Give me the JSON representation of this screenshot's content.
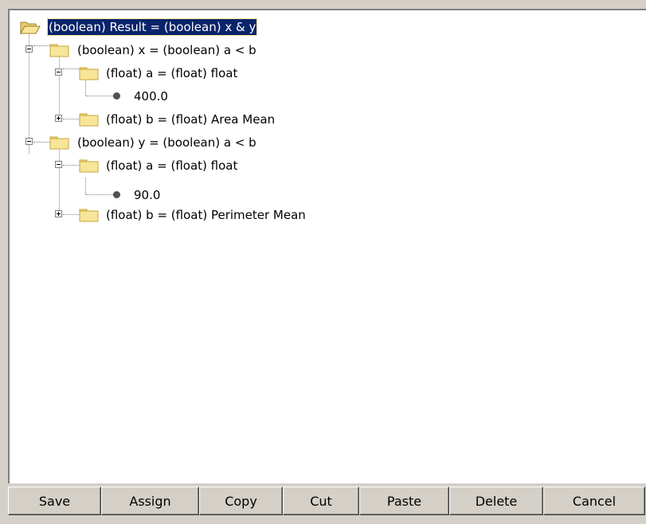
{
  "tree": {
    "nodes": [
      {
        "id": "root",
        "label": "(boolean) Result = (boolean) x & y",
        "icon": "open-folder-icon",
        "selected": true
      },
      {
        "id": "x",
        "label": "(boolean) x = (boolean) a < b",
        "icon": "folder-icon",
        "expander": "minus"
      },
      {
        "id": "x-a",
        "label": "(float) a = (float) float",
        "icon": "folder-icon",
        "expander": "minus"
      },
      {
        "id": "x-a-val",
        "label": "400.0",
        "icon": "bullet-icon"
      },
      {
        "id": "x-b",
        "label": "(float) b = (float) Area Mean",
        "icon": "folder-icon",
        "expander": "plus"
      },
      {
        "id": "y",
        "label": "(boolean) y = (boolean) a < b",
        "icon": "folder-icon",
        "expander": "minus"
      },
      {
        "id": "y-a",
        "label": "(float) a = (float) float",
        "icon": "folder-icon",
        "expander": "minus"
      },
      {
        "id": "y-a-val",
        "label": "90.0",
        "icon": "bullet-icon"
      },
      {
        "id": "y-b",
        "label": "(float) b = (float) Perimeter Mean",
        "icon": "folder-icon",
        "expander": "plus"
      }
    ]
  },
  "buttons": {
    "save": "Save",
    "assign": "Assign",
    "copy": "Copy",
    "cut": "Cut",
    "paste": "Paste",
    "delete": "Delete",
    "cancel": "Cancel"
  },
  "colors": {
    "window_bg": "#d4d0c8",
    "selection_bg": "#0a246a",
    "folder_fill": "#f5e28a",
    "folder_edge": "#c9a53a"
  }
}
